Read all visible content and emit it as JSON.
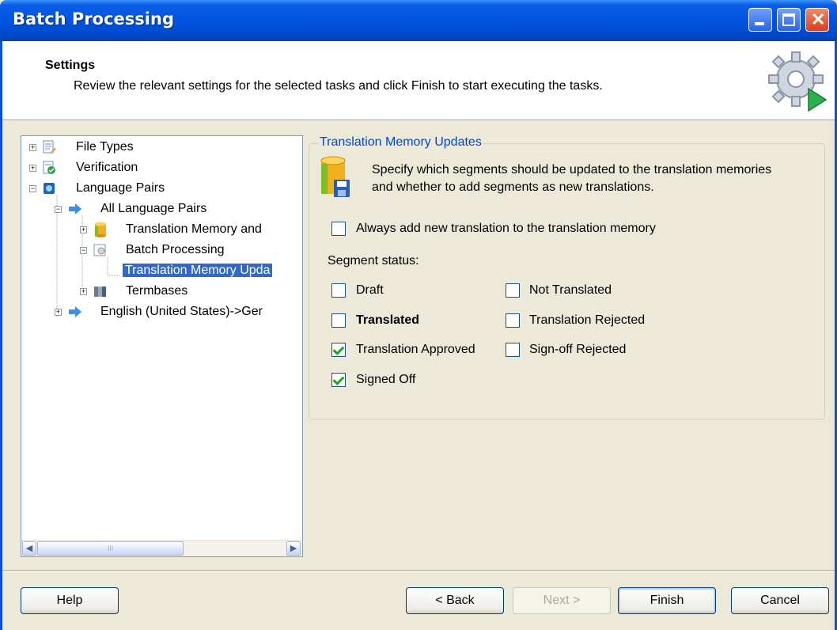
{
  "window": {
    "title": "Batch Processing"
  },
  "header": {
    "title": "Settings",
    "description": "Review the relevant settings for the selected tasks and click Finish to start executing the tasks."
  },
  "tree": {
    "items": [
      {
        "label": "File Types",
        "icon": "file-types-icon"
      },
      {
        "label": "Verification",
        "icon": "verification-icon"
      },
      {
        "label": "Language Pairs",
        "icon": "language-pairs-icon"
      },
      {
        "label": "All Language Pairs",
        "icon": "arrow-icon"
      },
      {
        "label": "Translation Memory and",
        "icon": "database-icon"
      },
      {
        "label": "Batch Processing",
        "icon": "batch-processing-icon"
      },
      {
        "label": "Translation Memory Upda",
        "icon": ""
      },
      {
        "label": "Termbases",
        "icon": "termbase-icon"
      },
      {
        "label": "English (United States)->Ger",
        "icon": "arrow-icon"
      }
    ],
    "scroll_thumb_grip": "III"
  },
  "panel": {
    "legend": "Translation Memory Updates",
    "description_line1": "Specify which segments should be updated to the translation memories",
    "description_line2": "and whether to add segments as new translations.",
    "always_add_label": "Always add new translation to the translation memory",
    "always_add_checked": false,
    "segment_status_label": "Segment status:",
    "statuses": [
      {
        "label": "Draft",
        "checked": false
      },
      {
        "label": "Not Translated",
        "checked": false
      },
      {
        "label": "Translated",
        "checked": false
      },
      {
        "label": "Translation Rejected",
        "checked": false
      },
      {
        "label": "Translation Approved",
        "checked": true
      },
      {
        "label": "Sign-off Rejected",
        "checked": false
      },
      {
        "label": "Signed Off",
        "checked": true
      }
    ]
  },
  "buttons": {
    "help": "Help",
    "back": "< Back",
    "next": "Next >",
    "finish": "Finish",
    "cancel": "Cancel"
  },
  "colors": {
    "title_bar": "#0054e3",
    "selection": "#316ac5",
    "legend_text": "#0046d5"
  }
}
